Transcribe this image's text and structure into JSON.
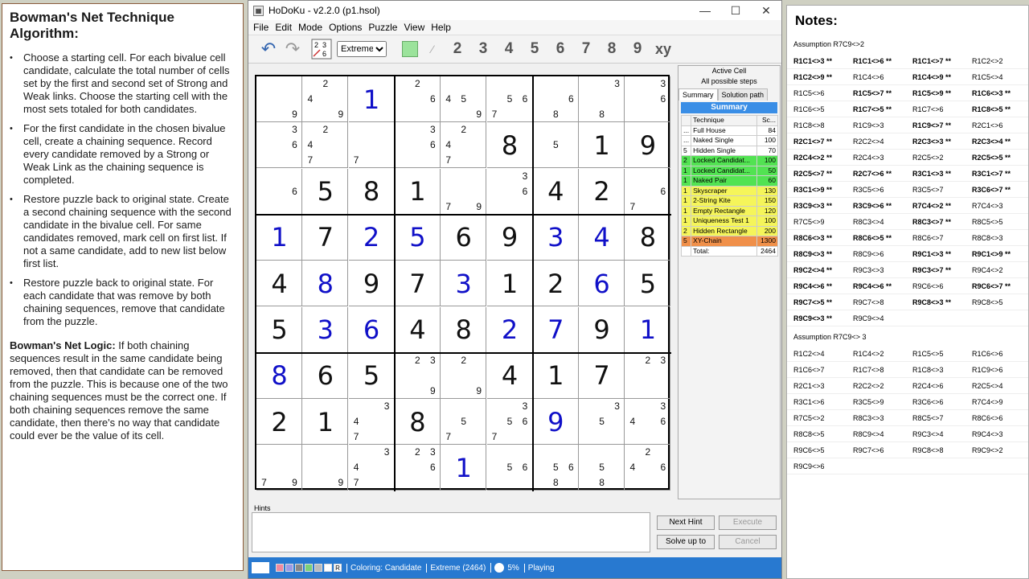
{
  "left": {
    "title": "Bowman's Net Technique Algorithm:",
    "bullets": [
      "Choose a starting cell. For each  bivalue cell candidate, calculate the total number of cells set by the first and second set of Strong and Weak links.  Choose the starting cell with the most sets totaled for both candidates.",
      "For the first candidate in the chosen bivalue cell, create  a chaining sequence.  Record every candidate removed by a Strong or Weak Link as the chaining sequence  is completed.",
      "Restore puzzle back to original state.  Create a second chaining sequence with the second candidate in the bivalue cell.  For same candidates removed, mark cell on first list.  If not a same candidate, add to new list below first list.",
      "Restore puzzle back to original state. For each candidate that was remove by both chaining sequences,  remove that candidate from the puzzle."
    ],
    "logic_label": "Bowman's Net Logic:",
    "logic_text": " If both chaining sequences  result in the same candidate being removed, then that candidate can be removed from the puzzle.  This is because  one of the two chaining sequences  must be the correct one. If both chaining sequences remove the same candidate, then there's no way that candidate could ever be the value of its cell."
  },
  "window": {
    "title": "HoDoKu - v2.2.0  (p1.hsol)",
    "menu": [
      "File",
      "Edit",
      "Mode",
      "Options",
      "Puzzle",
      "View",
      "Help"
    ],
    "difficulty": "Extreme",
    "digits": [
      "2",
      "3",
      "4",
      "5",
      "6",
      "7",
      "8",
      "9"
    ],
    "xy_label": "xy",
    "colors": {
      "accent": "#2879d0",
      "summary": "#3a8ee6",
      "solved": "#1010c8"
    }
  },
  "grid": [
    [
      {
        "c": [
          2,
          4,
          9
        ]
      },
      {
        "v": "1",
        "s": 1
      },
      {
        "c": [
          2,
          4,
          5,
          6,
          9
        ]
      },
      {
        "c": [
          5,
          6,
          7
        ]
      },
      {
        "c": [
          6,
          8
        ]
      },
      {
        "c": [
          3,
          8
        ]
      },
      {
        "c": [
          3,
          6
        ]
      }
    ],
    [],
    [],
    [],
    [],
    [],
    [],
    [],
    []
  ],
  "cells": [
    [
      [],
      [
        2,
        4,
        9
      ],
      [],
      "1S",
      [
        2,
        6
      ],
      [
        4,
        5,
        9
      ],
      [
        5,
        6,
        7
      ],
      [
        6,
        8
      ],
      [
        3,
        8
      ],
      [
        3,
        6
      ]
    ]
  ],
  "board": [
    [
      "c:9",
      "c:2,4,9",
      "v:1S",
      "c:2,6",
      "c:4,5,9",
      "c:5,6,7",
      "c:6,8",
      "c:3,8",
      "c:3,6"
    ],
    [
      "c:3,6",
      "c:2,4,7",
      "c:7",
      "c:3,6",
      "c:2,4,7",
      "v:8",
      "c:5",
      "v:1",
      "v:9"
    ],
    [
      "c:6",
      "v:5",
      "v:8",
      "v:1",
      "c:7,9",
      "c:3,6",
      "v:4",
      "v:2",
      "c:6,7"
    ],
    [
      "v:1S",
      "v:7",
      "v:2S",
      "v:5S",
      "v:6",
      "v:9",
      "v:3S",
      "v:4S",
      "v:8"
    ],
    [
      "v:4",
      "v:8S",
      "v:9",
      "v:7",
      "v:3S",
      "v:1",
      "v:2",
      "v:6S",
      "v:5"
    ],
    [
      "v:5",
      "v:3S",
      "v:6S",
      "v:4",
      "v:8",
      "v:2S",
      "v:7S",
      "v:9",
      "v:1S"
    ],
    [
      "v:8S",
      "v:6",
      "v:5",
      "c:2,3,9",
      "c:2,9",
      "v:4",
      "v:1",
      "v:7",
      "c:2,3"
    ],
    [
      "v:2",
      "v:1",
      "c:3,4,7",
      "v:8",
      "c:5,7",
      "c:3,5,6,7",
      "v:9S",
      "c:3,5",
      "c:3,4,6"
    ],
    [
      "c:7,9",
      "c:9",
      "c:3,4,7",
      "c:2,3,6",
      "v:1S",
      "c:5,6",
      "c:5,6,8",
      "c:5,8",
      "c:2,4,6"
    ]
  ],
  "summary": {
    "active": "Active Cell",
    "possible": "All possible steps",
    "tabs": [
      "Summary",
      "Solution path"
    ],
    "header": "Summary",
    "col_tech": "Technique",
    "col_score": "Sc...",
    "rows": [
      {
        "n": "...",
        "t": "Full House",
        "s": "84",
        "color": "#ffffff"
      },
      {
        "n": "...",
        "t": "Naked Single",
        "s": "100",
        "color": "#ffffff"
      },
      {
        "n": "5",
        "t": "Hidden Single",
        "s": "70",
        "color": "#ffffff"
      },
      {
        "n": "2",
        "t": "Locked Candidat...",
        "s": "100",
        "color": "#52e352"
      },
      {
        "n": "1",
        "t": "Locked Candidat...",
        "s": "50",
        "color": "#52e352"
      },
      {
        "n": "1",
        "t": "Naked Pair",
        "s": "60",
        "color": "#52e352"
      },
      {
        "n": "1",
        "t": "Skyscraper",
        "s": "130",
        "color": "#f5f55a"
      },
      {
        "n": "1",
        "t": "2-String Kite",
        "s": "150",
        "color": "#f5f55a"
      },
      {
        "n": "1",
        "t": "Empty Rectangle",
        "s": "120",
        "color": "#f5f55a"
      },
      {
        "n": "1",
        "t": "Uniqueness Test 1",
        "s": "100",
        "color": "#f5f55a"
      },
      {
        "n": "2",
        "t": "Hidden Rectangle",
        "s": "200",
        "color": "#f5f55a"
      },
      {
        "n": "5",
        "t": "XY-Chain",
        "s": "1300",
        "color": "#f0904a"
      }
    ],
    "total_label": "Total:",
    "total": "2464"
  },
  "hints": {
    "label": "Hints",
    "next": "Next Hint",
    "execute": "Execute",
    "solve": "Solve up to",
    "cancel": "Cancel"
  },
  "status": {
    "coloring": "Coloring: Candidate",
    "level": "Extreme (2464)",
    "percent": "5%",
    "state": "Playing",
    "r": "R"
  },
  "notes": {
    "title": "Notes:",
    "assume1": "Assumption R7C9<>2",
    "list1": [
      [
        "R1C1<>3 **",
        "R1C1<>6 **",
        "R1C1<>7 **",
        "R1C2<>2"
      ],
      [
        "R1C2<>9 **",
        "R1C4<>6",
        "R1C4<>9 **",
        "R1C5<>4"
      ],
      [
        "R1C5<>6",
        "R1C5<>7 **",
        "R1C5<>9 **",
        "R1C6<>3 **"
      ],
      [
        "R1C6<>5",
        "R1C7<>5 **",
        "R1C7<>6",
        "R1C8<>5 **"
      ],
      [
        "R1C8<>8",
        "R1C9<>3",
        "R1C9<>7 **",
        "R2C1<>6"
      ],
      [
        "R2C1<>7 **",
        "R2C2<>4",
        "R2C3<>3 **",
        "R2C3<>4 **"
      ],
      [
        "R2C4<>2 **",
        "R2C4<>3",
        "R2C5<>2",
        "R2C5<>5 **"
      ],
      [
        "R2C5<>7 **",
        "R2C7<>6 **",
        "R3C1<>3 **",
        "R3C1<>7 **"
      ],
      [
        "R3C1<>9 **",
        "R3C5<>6",
        "R3C5<>7",
        "R3C6<>7 **"
      ],
      [
        "R3C9<>3 **",
        "R3C9<>6 **",
        "R7C4<>2 **",
        "R7C4<>3"
      ],
      [
        "R7C5<>9",
        "R8C3<>4",
        "R8C3<>7 **",
        "R8C5<>5"
      ],
      [
        "R8C6<>3 **",
        "R8C6<>5 **",
        "R8C6<>7",
        "R8C8<>3"
      ],
      [
        "R8C9<>3 **",
        "R8C9<>6",
        "R9C1<>3 **",
        "R9C1<>9 **"
      ],
      [
        "R9C2<>4 **",
        "R9C3<>3",
        "R9C3<>7 **",
        "R9C4<>2"
      ],
      [
        "R9C4<>6 **",
        "R9C4<>6 **",
        "R9C6<>6",
        "R9C6<>7 **"
      ],
      [
        "R9C7<>5 **",
        "R9C7<>8",
        "R9C8<>3 **",
        "R9C8<>5"
      ],
      [
        "R9C9<>3 **",
        "R9C9<>4",
        "",
        ""
      ]
    ],
    "assume2": "Assumption R7C9<> 3",
    "list2": [
      [
        "R1C2<>4",
        "R1C4<>2",
        "R1C5<>5",
        "R1C6<>6"
      ],
      [
        "R1C6<>7",
        "R1C7<>8",
        "R1C8<>3",
        "R1C9<>6"
      ],
      [
        "R2C1<>3",
        "R2C2<>2",
        "R2C4<>6",
        "R2C5<>4"
      ],
      [
        "R3C1<>6",
        "R3C5<>9",
        "R3C6<>6",
        "R7C4<>9"
      ],
      [
        "R7C5<>2",
        "R8C3<>3",
        "R8C5<>7",
        "R8C6<>6"
      ],
      [
        "R8C8<>5",
        "R8C9<>4",
        "R9C3<>4",
        "R9C4<>3"
      ],
      [
        "R9C6<>5",
        "R9C7<>6",
        "R9C8<>8",
        "R9C9<>2"
      ],
      [
        "R9C9<>6",
        "",
        "",
        ""
      ]
    ]
  }
}
